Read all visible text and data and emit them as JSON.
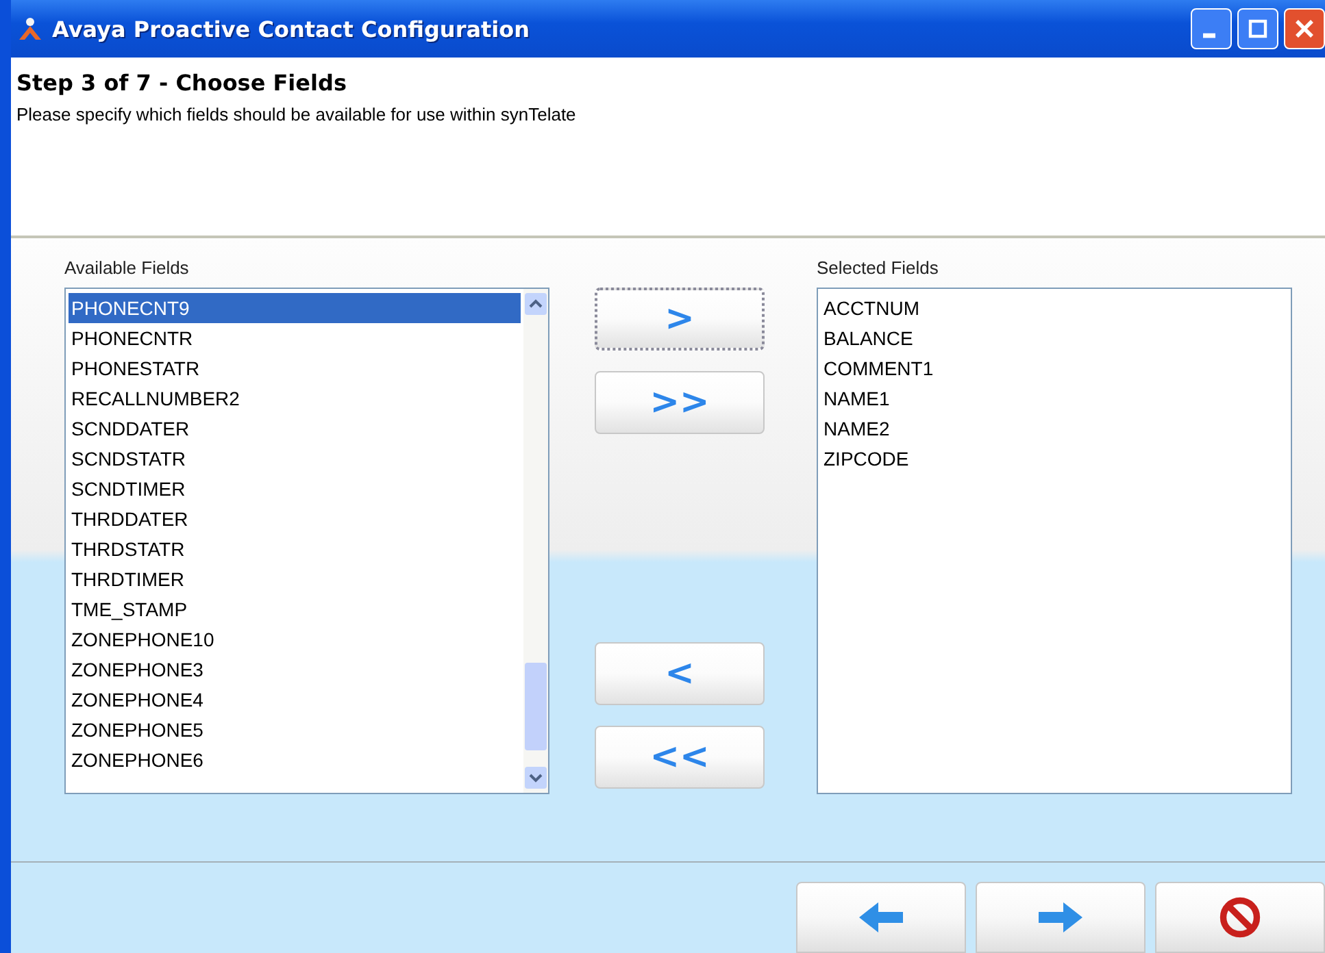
{
  "window": {
    "title": "Avaya Proactive Contact Configuration"
  },
  "header": {
    "title": "Step 3 of 7 - Choose Fields",
    "description": "Please specify which fields should be available for use within synTelate"
  },
  "available": {
    "label": "Available Fields",
    "items": [
      {
        "text": "PHONECNT9",
        "selected": true
      },
      {
        "text": "PHONECNTR",
        "selected": false
      },
      {
        "text": "PHONESTATR",
        "selected": false
      },
      {
        "text": "RECALLNUMBER2",
        "selected": false
      },
      {
        "text": "SCNDDATER",
        "selected": false
      },
      {
        "text": "SCNDSTATR",
        "selected": false
      },
      {
        "text": "SCNDTIMER",
        "selected": false
      },
      {
        "text": "THRDDATER",
        "selected": false
      },
      {
        "text": "THRDSTATR",
        "selected": false
      },
      {
        "text": "THRDTIMER",
        "selected": false
      },
      {
        "text": "TME_STAMP",
        "selected": false
      },
      {
        "text": "ZONEPHONE10",
        "selected": false
      },
      {
        "text": "ZONEPHONE3",
        "selected": false
      },
      {
        "text": "ZONEPHONE4",
        "selected": false
      },
      {
        "text": "ZONEPHONE5",
        "selected": false
      },
      {
        "text": "ZONEPHONE6",
        "selected": false
      }
    ]
  },
  "transfer_buttons": [
    {
      "label": ">",
      "focused": true
    },
    {
      "label": ">>",
      "focused": false
    },
    {
      "label": "<",
      "focused": false
    },
    {
      "label": "<<",
      "focused": false
    }
  ],
  "selected": {
    "label": "Selected Fields",
    "items": [
      {
        "text": "ACCTNUM",
        "selected": false
      },
      {
        "text": "BALANCE",
        "selected": false
      },
      {
        "text": "COMMENT1",
        "selected": false
      },
      {
        "text": "NAME1",
        "selected": false
      },
      {
        "text": "NAME2",
        "selected": false
      },
      {
        "text": "ZIPCODE",
        "selected": false
      }
    ]
  },
  "nav_buttons": [
    {
      "kind": "back"
    },
    {
      "kind": "next"
    },
    {
      "kind": "cancel"
    }
  ]
}
